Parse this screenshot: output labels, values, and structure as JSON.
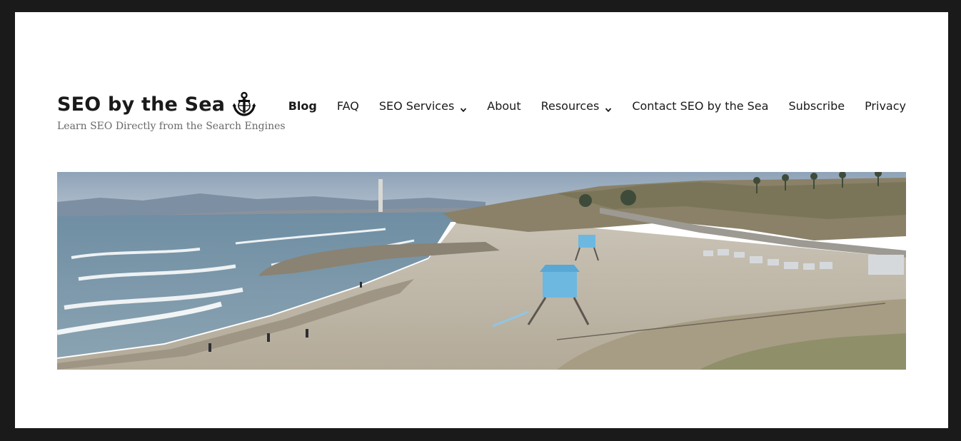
{
  "site": {
    "title": "SEO by the Sea",
    "tagline": "Learn SEO Directly from the Search Engines",
    "logo_icon": "anchor-icon"
  },
  "nav": {
    "items": [
      {
        "label": "Blog",
        "current": true,
        "has_submenu": false
      },
      {
        "label": "FAQ",
        "current": false,
        "has_submenu": false
      },
      {
        "label": "SEO Services",
        "current": false,
        "has_submenu": true
      },
      {
        "label": "About",
        "current": false,
        "has_submenu": false
      },
      {
        "label": "Resources",
        "current": false,
        "has_submenu": true
      },
      {
        "label": "Contact SEO by the Sea",
        "current": false,
        "has_submenu": false
      },
      {
        "label": "Subscribe",
        "current": false,
        "has_submenu": false
      },
      {
        "label": "Privacy",
        "current": false,
        "has_submenu": false
      }
    ]
  },
  "header_image": {
    "subject": "beach-panorama"
  },
  "colors": {
    "frame": "#1a1a1a",
    "page": "#ffffff",
    "text": "#1a1a1a",
    "tagline": "#686868"
  }
}
